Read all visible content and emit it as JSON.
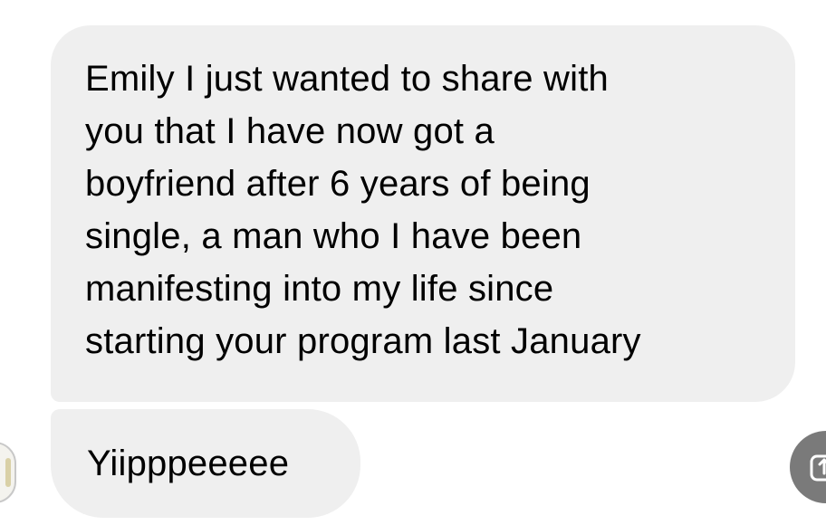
{
  "messages": [
    {
      "sender": "other",
      "lines": [
        "Emily I just wanted to share with",
        "you that I have now got a",
        "boyfriend after 6 years of being",
        "single, a man who I have been",
        "manifesting into my life since",
        "starting your program last January"
      ]
    },
    {
      "sender": "other",
      "text": "Yiipppeeeee"
    }
  ],
  "icons": {
    "avatar": "avatar-partial",
    "share": "share-icon"
  },
  "colors": {
    "bubble": "#efefef",
    "text": "#000000",
    "share_button": "#7a7a7a"
  }
}
